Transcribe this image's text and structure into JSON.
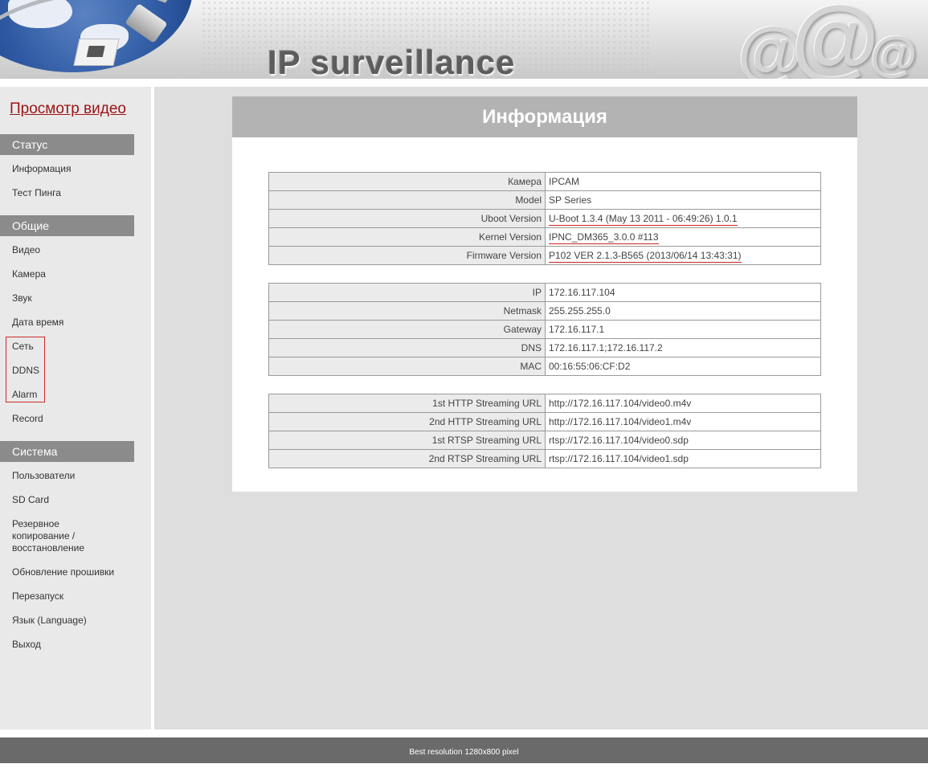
{
  "header": {
    "brand": "IP surveillance",
    "at_symbols": [
      "@",
      "@",
      "@"
    ]
  },
  "sidebar": {
    "top_link": "Просмотр видео",
    "sections": [
      {
        "title": "Статус",
        "items": [
          "Информация",
          "Тест Пинга"
        ]
      },
      {
        "title": "Общие",
        "items": [
          "Видео",
          "Камера",
          "Звук",
          "Дата время",
          "Сеть",
          "DDNS",
          "Alarm",
          "Record"
        ]
      },
      {
        "title": "Система",
        "items": [
          "Пользователи",
          "SD Card",
          "Резервное копирование / восстановление",
          "Обновление прошивки",
          "Перезапуск",
          "Язык (Language)",
          "Выход"
        ]
      }
    ]
  },
  "main": {
    "title": "Информация",
    "device_table": [
      {
        "label": "Камера",
        "value": "IPCAM"
      },
      {
        "label": "Model",
        "value": "SP Series"
      },
      {
        "label": "Uboot Version",
        "value": "U-Boot 1.3.4 (May 13 2011 - 06:49:26) 1.0.1"
      },
      {
        "label": "Kernel Version",
        "value": "IPNC_DM365_3.0.0 #113"
      },
      {
        "label": "Firmware Version",
        "value": "P102 VER 2.1.3-B565 (2013/06/14 13:43:31)"
      }
    ],
    "network_table": [
      {
        "label": "IP",
        "value": "172.16.117.104"
      },
      {
        "label": "Netmask",
        "value": "255.255.255.0"
      },
      {
        "label": "Gateway",
        "value": "172.16.117.1"
      },
      {
        "label": "DNS",
        "value": "172.16.117.1;172.16.117.2"
      },
      {
        "label": "MAC",
        "value": "00:16:55:06:CF:D2"
      }
    ],
    "streaming_table": [
      {
        "label": "1st HTTP Streaming URL",
        "value": "http://172.16.117.104/video0.m4v"
      },
      {
        "label": "2nd HTTP Streaming URL",
        "value": "http://172.16.117.104/video1.m4v"
      },
      {
        "label": "1st RTSP Streaming URL",
        "value": "rtsp://172.16.117.104/video0.sdp"
      },
      {
        "label": "2nd RTSP Streaming URL",
        "value": "rtsp://172.16.117.104/video1.sdp"
      }
    ]
  },
  "footer": {
    "text": "Best resolution 1280x800 pixel"
  },
  "colors": {
    "section_header_bg": "#8b8b8b",
    "link_red": "#9b1414",
    "highlight_red": "#cc2b2b",
    "footer_bg": "#6a6a6a"
  }
}
